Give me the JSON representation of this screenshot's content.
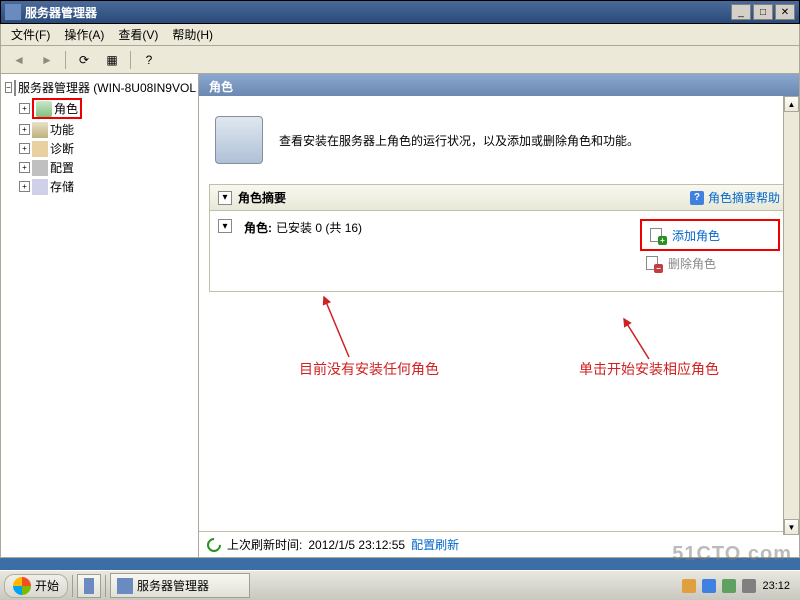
{
  "window": {
    "title": "服务器管理器"
  },
  "menu": {
    "file": "文件(F)",
    "action": "操作(A)",
    "view": "查看(V)",
    "help": "帮助(H)"
  },
  "tree": {
    "root": "服务器管理器 (WIN-8U08IN9VOL",
    "roles": "角色",
    "features": "功能",
    "diagnostics": "诊断",
    "config": "配置",
    "storage": "存储"
  },
  "content": {
    "header": "角色",
    "description": "查看安装在服务器上角色的运行状况，以及添加或删除角色和功能。",
    "summary_title": "角色摘要",
    "summary_help": "角色摘要帮助",
    "roles_label": "角色",
    "roles_installed": "已安装 0 (共 16)",
    "add_role": "添加角色",
    "remove_role": "删除角色",
    "last_refresh_label": "上次刷新时间:",
    "last_refresh_time": "2012/1/5 23:12:55",
    "config_refresh": "配置刷新"
  },
  "annotations": {
    "no_roles": "目前没有安装任何角色",
    "click_install": "单击开始安装相应角色"
  },
  "taskbar": {
    "start": "开始",
    "app": "服务器管理器",
    "clock": "23:12"
  },
  "watermark": "51CTO.com"
}
